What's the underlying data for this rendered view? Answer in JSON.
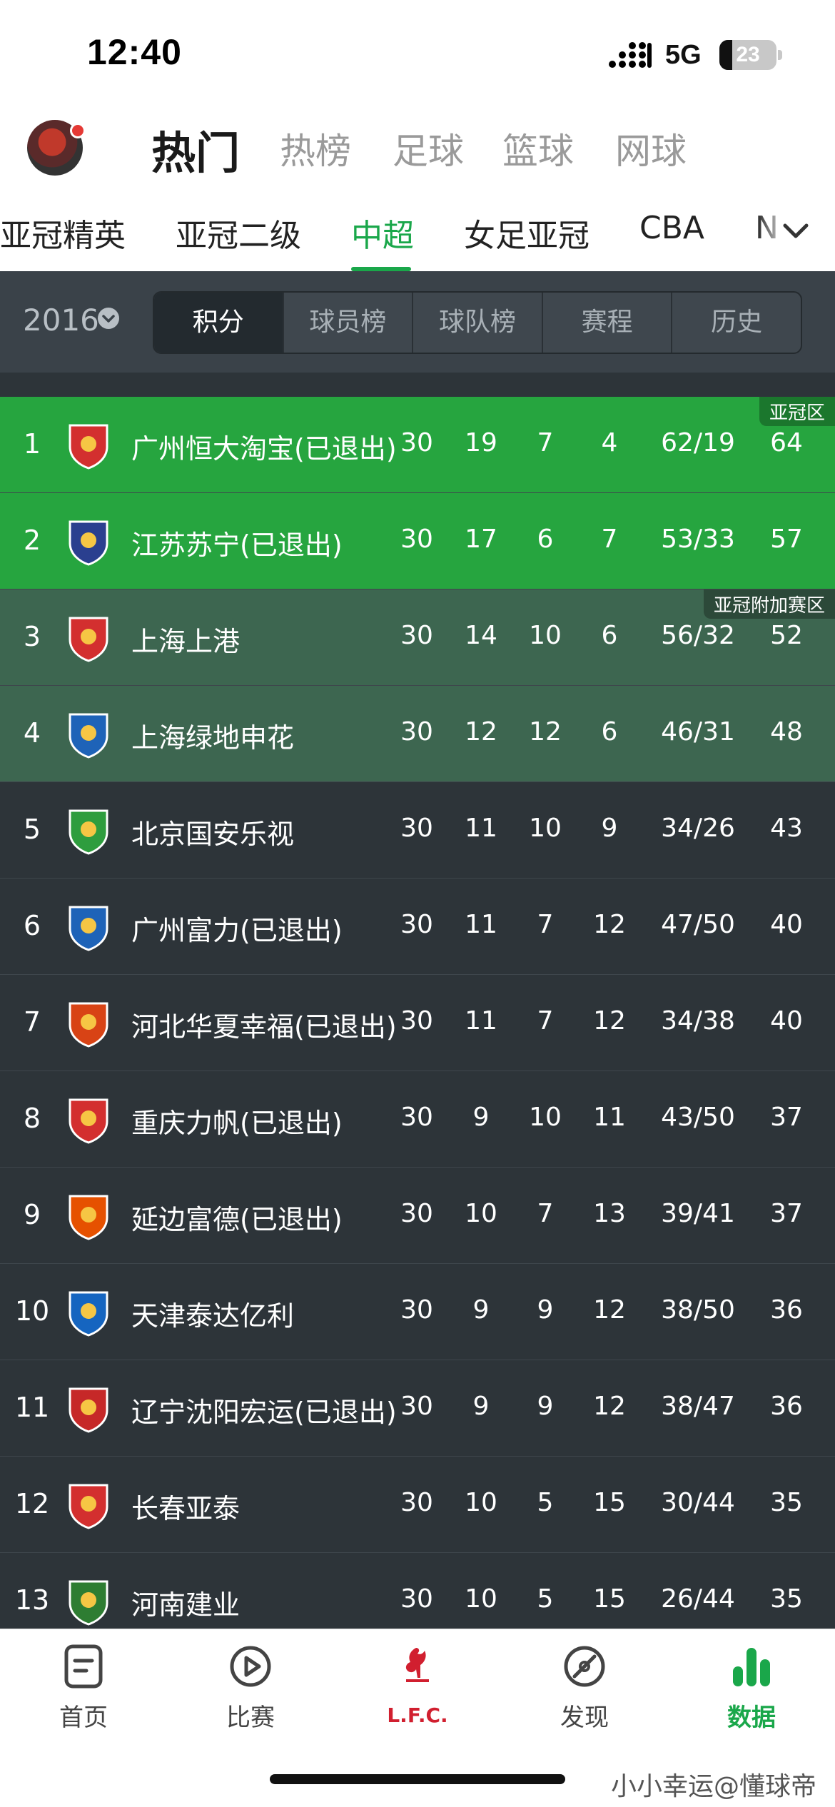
{
  "status_bar": {
    "time": "12:40",
    "network": "5G",
    "battery": "23",
    "battery_level": 0.23
  },
  "top_nav": {
    "tabs": [
      {
        "label": "热门",
        "active": true
      },
      {
        "label": "热榜"
      },
      {
        "label": "足球"
      },
      {
        "label": "篮球"
      },
      {
        "label": "网球"
      }
    ]
  },
  "league_tabs": {
    "items": [
      "亚冠精英",
      "亚冠二级",
      "中超",
      "女足亚冠",
      "CBA",
      "N"
    ],
    "active": "中超",
    "more_icon": "chevron-down-icon"
  },
  "filter": {
    "year": "2016",
    "segments": [
      "积分",
      "球员榜",
      "球队榜",
      "赛程",
      "历史"
    ],
    "active_segment": "积分"
  },
  "zones": {
    "acl": "亚冠区",
    "acl_playoff": "亚冠附加赛区"
  },
  "colors": {
    "accent": "#1aa74a",
    "acl_zone": "#26a53f",
    "playoff_zone": "#3d6650",
    "dark_bg": "#2d3439"
  },
  "standings": [
    {
      "rank": "1",
      "team": "广州恒大淘宝(已退出)",
      "played": "30",
      "won": "19",
      "drawn": "7",
      "lost": "4",
      "goals": "62/19",
      "points": "64",
      "zone": "acl",
      "logo": "#d32f2f"
    },
    {
      "rank": "2",
      "team": "江苏苏宁(已退出)",
      "played": "30",
      "won": "17",
      "drawn": "6",
      "lost": "7",
      "goals": "53/33",
      "points": "57",
      "zone": "acl",
      "logo": "#2a3f8f"
    },
    {
      "rank": "3",
      "team": "上海上港",
      "played": "30",
      "won": "14",
      "drawn": "10",
      "lost": "6",
      "goals": "56/32",
      "points": "52",
      "zone": "acl_playoff",
      "logo": "#d32f2f"
    },
    {
      "rank": "4",
      "team": "上海绿地申花",
      "played": "30",
      "won": "12",
      "drawn": "12",
      "lost": "6",
      "goals": "46/31",
      "points": "48",
      "zone": "acl_playoff",
      "logo": "#1e63b8"
    },
    {
      "rank": "5",
      "team": "北京国安乐视",
      "played": "30",
      "won": "11",
      "drawn": "10",
      "lost": "9",
      "goals": "34/26",
      "points": "43",
      "logo": "#2e9d3e"
    },
    {
      "rank": "6",
      "team": "广州富力(已退出)",
      "played": "30",
      "won": "11",
      "drawn": "7",
      "lost": "12",
      "goals": "47/50",
      "points": "40",
      "logo": "#1e63b8"
    },
    {
      "rank": "7",
      "team": "河北华夏幸福(已退出)",
      "played": "30",
      "won": "11",
      "drawn": "7",
      "lost": "12",
      "goals": "34/38",
      "points": "40",
      "logo": "#d84315"
    },
    {
      "rank": "8",
      "team": "重庆力帆(已退出)",
      "played": "30",
      "won": "9",
      "drawn": "10",
      "lost": "11",
      "goals": "43/50",
      "points": "37",
      "logo": "#d32f2f"
    },
    {
      "rank": "9",
      "team": "延边富德(已退出)",
      "played": "30",
      "won": "10",
      "drawn": "7",
      "lost": "13",
      "goals": "39/41",
      "points": "37",
      "logo": "#e65100"
    },
    {
      "rank": "10",
      "team": "天津泰达亿利",
      "played": "30",
      "won": "9",
      "drawn": "9",
      "lost": "12",
      "goals": "38/50",
      "points": "36",
      "logo": "#1565c0"
    },
    {
      "rank": "11",
      "team": "辽宁沈阳宏运(已退出)",
      "played": "30",
      "won": "9",
      "drawn": "9",
      "lost": "12",
      "goals": "38/47",
      "points": "36",
      "logo": "#c62828"
    },
    {
      "rank": "12",
      "team": "长春亚泰",
      "played": "30",
      "won": "10",
      "drawn": "5",
      "lost": "15",
      "goals": "30/44",
      "points": "35",
      "logo": "#d32f2f"
    },
    {
      "rank": "13",
      "team": "河南建业",
      "played": "30",
      "won": "10",
      "drawn": "5",
      "lost": "15",
      "goals": "26/44",
      "points": "35",
      "logo": "#2e7d32"
    }
  ],
  "bottom_tabs": [
    {
      "label": "首页",
      "icon": "document-icon"
    },
    {
      "label": "比赛",
      "icon": "play-icon"
    },
    {
      "label": "L.F.C.",
      "icon": "lfc-liverbird-icon"
    },
    {
      "label": "发现",
      "icon": "compass-icon"
    },
    {
      "label": "数据",
      "icon": "bar-chart-icon",
      "active": true
    }
  ],
  "watermark": "小小幸运@懂球帝"
}
